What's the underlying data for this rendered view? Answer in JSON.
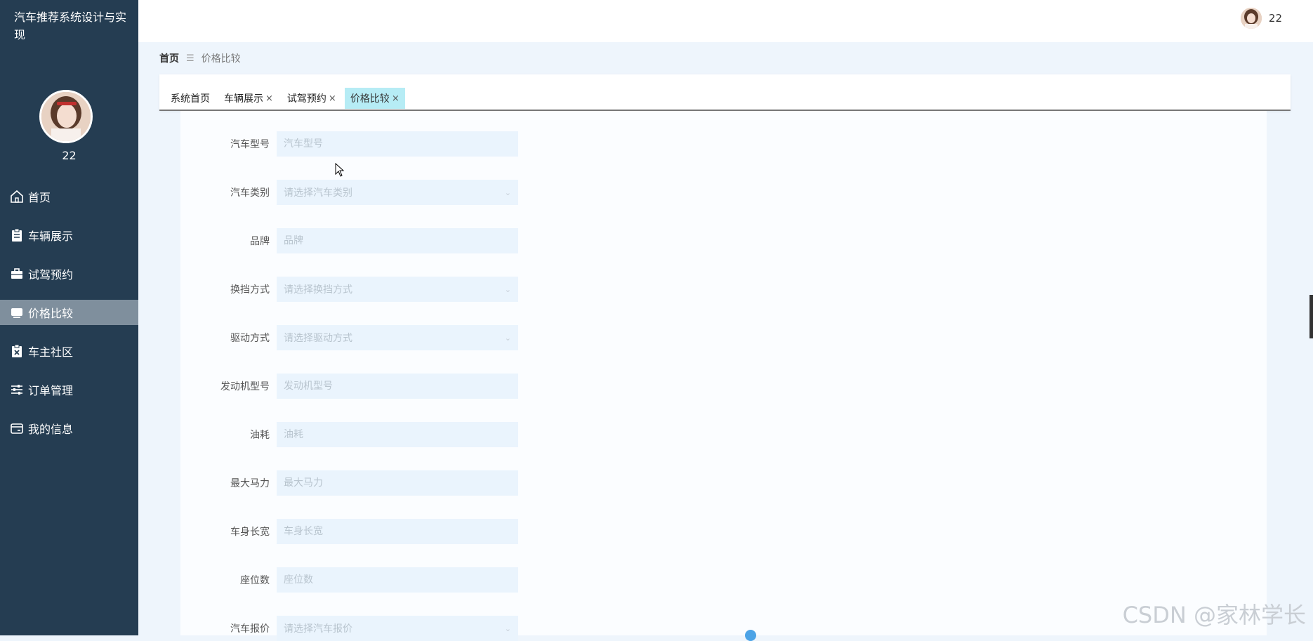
{
  "app_title": "汽车推荐系统设计与实现",
  "user": {
    "name": "22"
  },
  "menu": [
    {
      "label": "首页",
      "icon": "home-icon"
    },
    {
      "label": "车辆展示",
      "icon": "clipboard-icon"
    },
    {
      "label": "试驾预约",
      "icon": "briefcase-icon"
    },
    {
      "label": "价格比较",
      "icon": "monitor-icon",
      "active": true
    },
    {
      "label": "车主社区",
      "icon": "clipboard-x-icon"
    },
    {
      "label": "订单管理",
      "icon": "sliders-icon"
    },
    {
      "label": "我的信息",
      "icon": "card-icon"
    }
  ],
  "breadcrumb": {
    "home": "首页",
    "separator": "☰",
    "current": "价格比较"
  },
  "tabs": [
    {
      "label": "系统首页",
      "closable": false
    },
    {
      "label": "车辆展示",
      "closable": true
    },
    {
      "label": "试驾预约",
      "closable": true
    },
    {
      "label": "价格比较",
      "closable": true,
      "active": true
    }
  ],
  "close_glyph": "×",
  "form": {
    "fields": [
      {
        "label": "汽车型号",
        "placeholder": "汽车型号",
        "type": "input"
      },
      {
        "label": "汽车类别",
        "placeholder": "请选择汽车类别",
        "type": "select"
      },
      {
        "label": "品牌",
        "placeholder": "品牌",
        "type": "input"
      },
      {
        "label": "换挡方式",
        "placeholder": "请选择换挡方式",
        "type": "select"
      },
      {
        "label": "驱动方式",
        "placeholder": "请选择驱动方式",
        "type": "select"
      },
      {
        "label": "发动机型号",
        "placeholder": "发动机型号",
        "type": "input"
      },
      {
        "label": "油耗",
        "placeholder": "油耗",
        "type": "input"
      },
      {
        "label": "最大马力",
        "placeholder": "最大马力",
        "type": "input"
      },
      {
        "label": "车身长宽",
        "placeholder": "车身长宽",
        "type": "input"
      },
      {
        "label": "座位数",
        "placeholder": "座位数",
        "type": "input"
      },
      {
        "label": "汽车报价",
        "placeholder": "请选择汽车报价",
        "type": "select"
      }
    ]
  },
  "watermark": "CSDN @家林学长",
  "colors": {
    "sidebar": "#253d52",
    "active_menu": "#7f8f9d",
    "active_tab": "#b6ecf5",
    "input_bg": "#eaf4fd"
  }
}
